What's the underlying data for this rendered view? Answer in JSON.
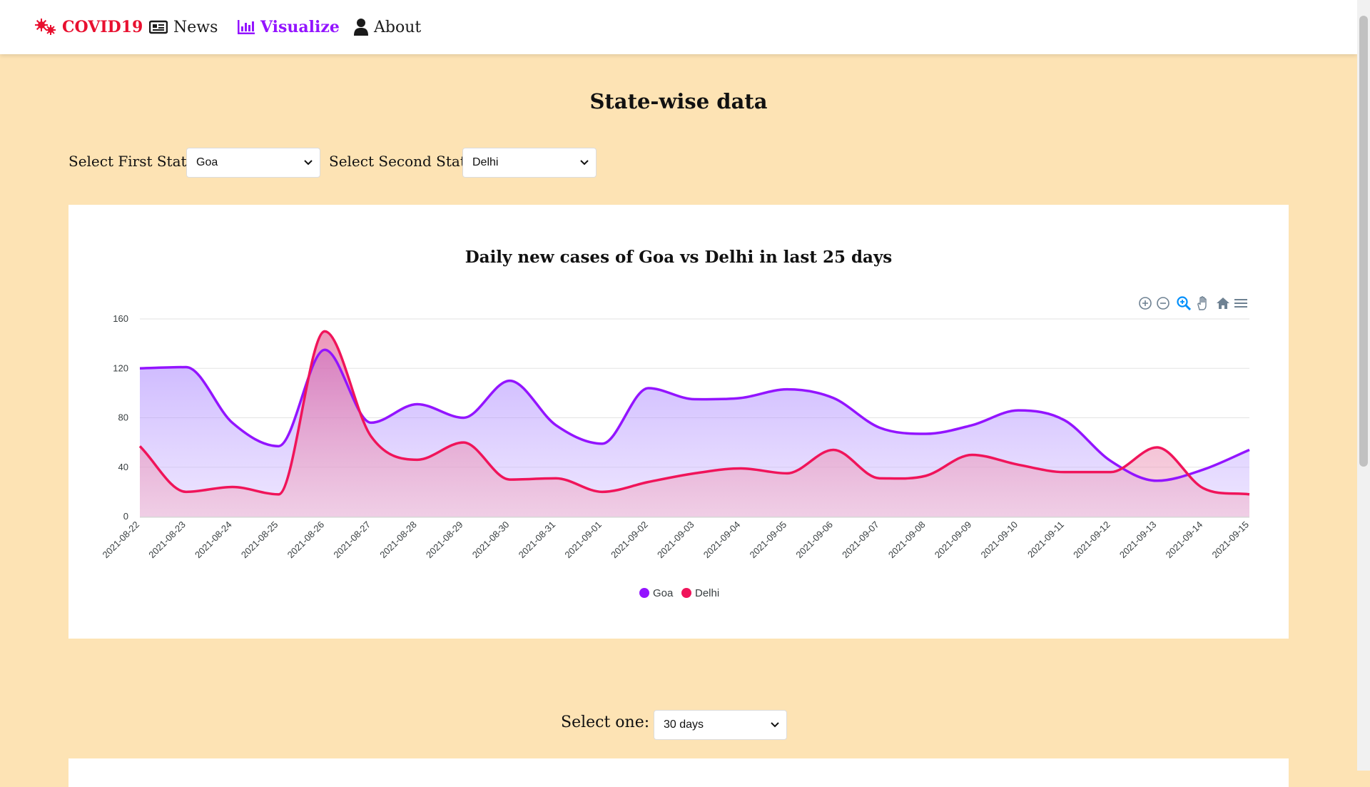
{
  "nav": {
    "brand": "COVID19",
    "news": "News",
    "visualize": "Visualize",
    "about": "About"
  },
  "colors": {
    "brand": "#e8102f",
    "active": "#9314ff",
    "background": "#fde3b4",
    "goa": "#9314ff",
    "delhi": "#f0145a"
  },
  "icons": {
    "brand": "virus-icon",
    "news": "newspaper-icon",
    "visualize": "bar-chart-icon",
    "about": "user-icon",
    "toolbar": [
      "zoom-in-icon",
      "zoom-out-icon",
      "zoom-selection-icon",
      "pan-hand-icon",
      "reset-home-icon",
      "menu-icon"
    ]
  },
  "page": {
    "title": "State-wise data",
    "first_state_label": "Select First State:",
    "first_state_value": "Goa",
    "second_state_label": "Select Second State:",
    "second_state_value": "Delhi",
    "period_label": "Select one:",
    "period_value": "30 days"
  },
  "chart_data": {
    "type": "area",
    "title": "Daily new cases of Goa vs Delhi in last 25 days",
    "xlabel": "",
    "ylabel": "",
    "ylim": [
      0,
      160
    ],
    "yticks": [
      0,
      40,
      80,
      120,
      160
    ],
    "grid": true,
    "legend_position": "bottom-center",
    "x": [
      "2021-08-22",
      "2021-08-23",
      "2021-08-24",
      "2021-08-25",
      "2021-08-26",
      "2021-08-27",
      "2021-08-28",
      "2021-08-29",
      "2021-08-30",
      "2021-08-31",
      "2021-09-01",
      "2021-09-02",
      "2021-09-03",
      "2021-09-04",
      "2021-09-05",
      "2021-09-06",
      "2021-09-07",
      "2021-09-08",
      "2021-09-09",
      "2021-09-10",
      "2021-09-11",
      "2021-09-12",
      "2021-09-13",
      "2021-09-14",
      "2021-09-15"
    ],
    "series": [
      {
        "name": "Goa",
        "values": [
          120,
          121,
          76,
          57,
          135,
          76,
          91,
          80,
          110,
          74,
          59,
          104,
          95,
          96,
          103,
          96,
          72,
          67,
          74,
          86,
          78,
          45,
          29,
          38,
          54
        ]
      },
      {
        "name": "Delhi",
        "values": [
          57,
          20,
          24,
          18,
          150,
          65,
          46,
          60,
          30,
          31,
          20,
          28,
          35,
          39,
          35,
          54,
          31,
          33,
          50,
          42,
          36,
          36,
          56,
          23,
          18
        ]
      }
    ]
  }
}
